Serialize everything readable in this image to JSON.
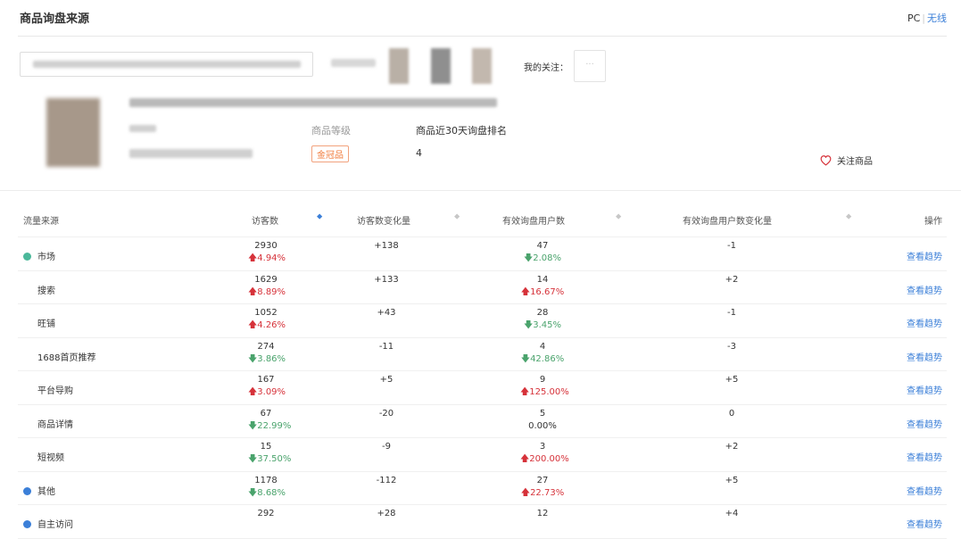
{
  "header": {
    "title": "商品询盘来源",
    "pc": "PC",
    "separator": "|",
    "wireless": "无线"
  },
  "follow": {
    "label": "我的关注：",
    "placeholder": "···"
  },
  "product": {
    "grade_label": "商品等级",
    "grade_badge": "金冠品",
    "rank_label": "商品近30天询盘排名",
    "rank_value": "4",
    "follow_button": "关注商品"
  },
  "table": {
    "headers": {
      "source": "流量来源",
      "visitors": "访客数",
      "visitors_change": "访客数变化量",
      "users": "有效询盘用户数",
      "users_change": "有效询盘用户数变化量",
      "action": "操作"
    },
    "sort_icon": "⬥",
    "rows": [
      {
        "name": "市场",
        "dot": "#4bb89a",
        "child": false,
        "visitors": "2930",
        "vpct": "4.94%",
        "vdir": "up",
        "vchg": "+138",
        "users": "47",
        "upct": "2.08%",
        "udir": "dn",
        "uchg": "-1",
        "op": "查看趋势"
      },
      {
        "name": "搜索",
        "child": true,
        "visitors": "1629",
        "vpct": "8.89%",
        "vdir": "up",
        "vchg": "+133",
        "users": "14",
        "upct": "16.67%",
        "udir": "up",
        "uchg": "+2",
        "op": "查看趋势"
      },
      {
        "name": "旺铺",
        "child": true,
        "visitors": "1052",
        "vpct": "4.26%",
        "vdir": "up",
        "vchg": "+43",
        "users": "28",
        "upct": "3.45%",
        "udir": "dn",
        "uchg": "-1",
        "op": "查看趋势"
      },
      {
        "name": "1688首页推荐",
        "child": true,
        "visitors": "274",
        "vpct": "3.86%",
        "vdir": "dn",
        "vchg": "-11",
        "users": "4",
        "upct": "42.86%",
        "udir": "dn",
        "uchg": "-3",
        "op": "查看趋势"
      },
      {
        "name": "平台导购",
        "child": true,
        "visitors": "167",
        "vpct": "3.09%",
        "vdir": "up",
        "vchg": "+5",
        "users": "9",
        "upct": "125.00%",
        "udir": "up",
        "uchg": "+5",
        "op": "查看趋势"
      },
      {
        "name": "商品详情",
        "child": true,
        "visitors": "67",
        "vpct": "22.99%",
        "vdir": "dn",
        "vchg": "-20",
        "users": "5",
        "upct": "0.00%",
        "udir": "none",
        "uchg": "0",
        "op": "查看趋势"
      },
      {
        "name": "短视频",
        "child": true,
        "visitors": "15",
        "vpct": "37.50%",
        "vdir": "dn",
        "vchg": "-9",
        "users": "3",
        "upct": "200.00%",
        "udir": "up",
        "uchg": "+2",
        "op": "查看趋势"
      },
      {
        "name": "其他",
        "dot": "#3b7fd8",
        "child": false,
        "visitors": "1178",
        "vpct": "8.68%",
        "vdir": "dn",
        "vchg": "-112",
        "users": "27",
        "upct": "22.73%",
        "udir": "up",
        "uchg": "+5",
        "op": "查看趋势"
      },
      {
        "name": "自主访问",
        "dot": "#3b7fd8",
        "child": false,
        "visitors": "292",
        "vpct": "",
        "vdir": "none",
        "vchg": "+28",
        "users": "12",
        "upct": "",
        "udir": "none",
        "uchg": "+4",
        "op": "查看趋势"
      }
    ]
  },
  "colors": {
    "link": "#3b7fd8",
    "up": "#d6323a",
    "down": "#4aa36c",
    "badge": "#f07a3a"
  }
}
